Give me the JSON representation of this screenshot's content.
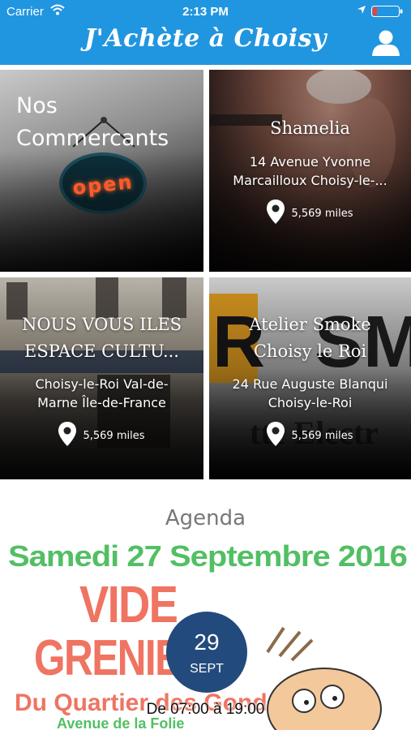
{
  "status_bar": {
    "carrier": "Carrier",
    "time": "2:13 PM"
  },
  "header": {
    "title": "J'Achète à Choisy",
    "background": "#2196e0",
    "user_icon": "user-icon"
  },
  "tiles": [
    {
      "title": "Nos Commercants",
      "title_lines": [
        "Nos",
        "Commercants"
      ],
      "image": "open sign",
      "sign_text": "open"
    },
    {
      "title": "Shamelia",
      "address": "14 Avenue Yvonne Marcailloux Choisy-le-...",
      "address_lines": [
        "14 Avenue Yvonne",
        "Marcailloux Choisy-le-..."
      ],
      "distance": "5,569 miles",
      "image": "hair dryer"
    },
    {
      "title": "NOUS VOUS ILES ESPACE CULTU...",
      "title_lines": [
        "NOUS VOUS ILES",
        "ESPACE CULTU..."
      ],
      "address": "Choisy-le-Roi Val-de-Marne Île-de-France",
      "address_lines": [
        "Choisy-le-Roi Val-de-",
        "Marne Île-de-France"
      ],
      "distance": "5,569 miles",
      "image": "building facade"
    },
    {
      "title": "Atelier Smoke Choisy le Roi",
      "title_lines": [
        "Atelier Smoke",
        "Choisy le Roi"
      ],
      "address": "24 Rue Auguste Blanqui Choisy-le-Roi",
      "address_lines": [
        "24 Rue Auguste Blanqui",
        "Choisy-le-Roi"
      ],
      "distance": "5,569 miles",
      "image": "shop sign"
    }
  ],
  "agenda": {
    "heading": "Agenda",
    "poster": {
      "line1": "Samedi 27 Septembre 2016",
      "line2": "VIDE",
      "line3": "GRENIER",
      "line4": "Du Quartier des Gondoles",
      "line5": "Avenue de la Folie"
    },
    "day": "29",
    "month": "SEPT",
    "time": "De 07:00 à 19:00",
    "badge_color": "#234a7c"
  }
}
